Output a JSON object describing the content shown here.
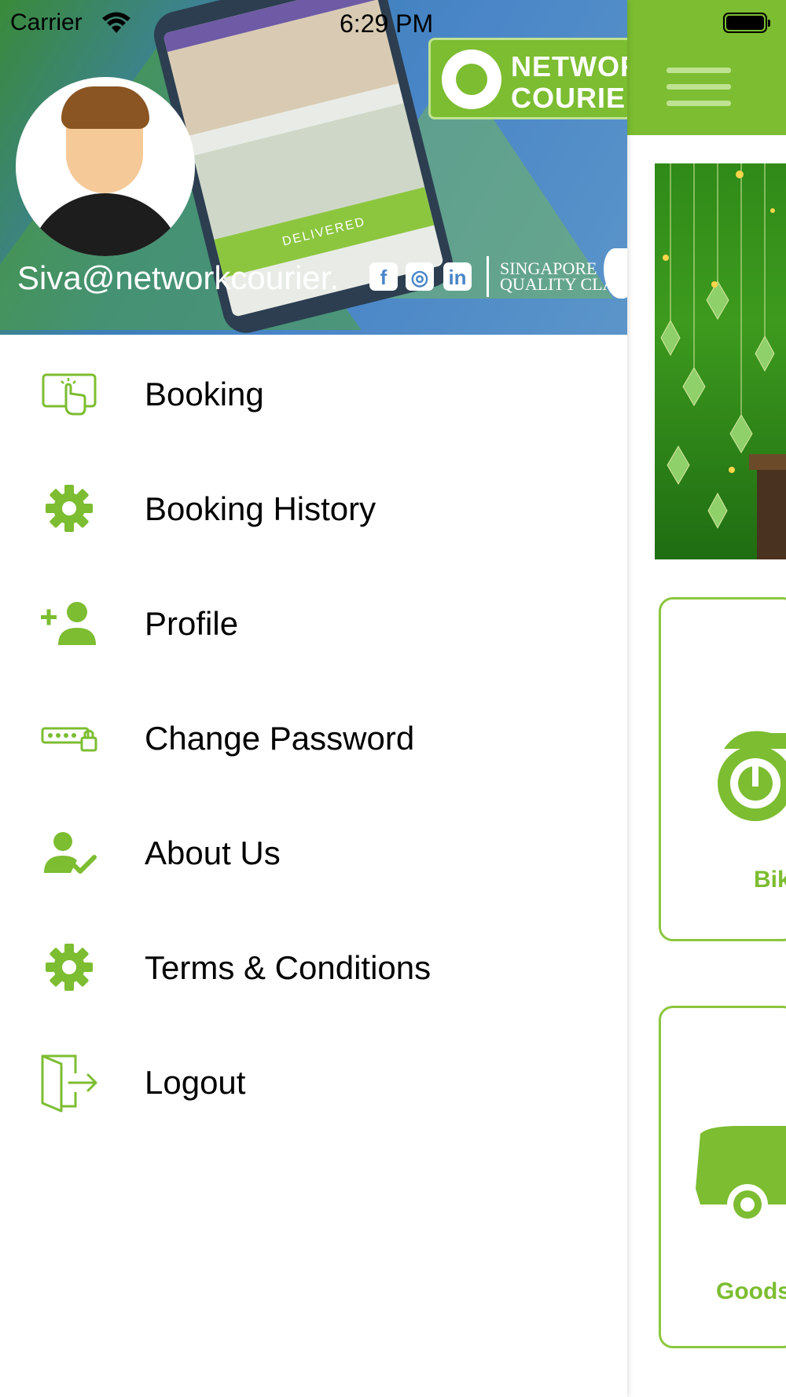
{
  "status_bar": {
    "carrier": "Carrier",
    "time": "6:29 PM"
  },
  "colors": {
    "brand_green": "#7cbd31",
    "light_green": "#bfe292",
    "header_blue": "#4a86c8"
  },
  "drawer": {
    "header": {
      "email": "Siva@networkcourier.",
      "logo_text": "NETWORK\nCOURIER",
      "phone_status": "DELIVERED",
      "quality_badge": "SINGAPORE\nQUALITY CLASS",
      "social_icons": [
        "facebook-icon",
        "instagram-icon",
        "linkedin-icon"
      ]
    },
    "menu": [
      {
        "label": "Booking",
        "icon": "touch-screen-icon"
      },
      {
        "label": "Booking History",
        "icon": "gear-icon"
      },
      {
        "label": "Profile",
        "icon": "add-user-icon"
      },
      {
        "label": "Change Password",
        "icon": "password-lock-icon"
      },
      {
        "label": "About Us",
        "icon": "user-check-icon"
      },
      {
        "label": "Terms & Conditions",
        "icon": "gear-icon"
      },
      {
        "label": "Logout",
        "icon": "logout-door-icon"
      }
    ]
  },
  "main": {
    "menu_button_icon": "hamburger-menu-icon",
    "cards": [
      {
        "label": "Bik",
        "icon": "scooter-icon"
      },
      {
        "label": "Goods",
        "icon": "van-icon"
      }
    ]
  }
}
